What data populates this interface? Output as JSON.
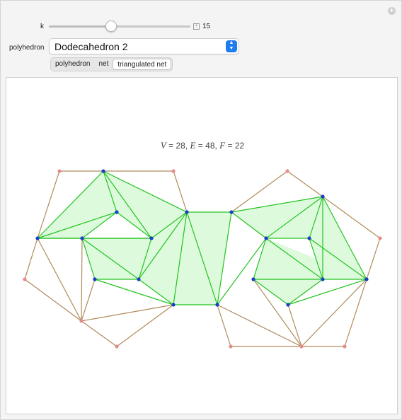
{
  "controls": {
    "k_label": "k",
    "k_value": "15",
    "k_fraction": 0.44,
    "polyhedron_label": "polyhedron",
    "polyhedron_selected": "Dodecahedron 2",
    "view_tabs": [
      {
        "label": "polyhedron",
        "active": false
      },
      {
        "label": "net",
        "active": false
      },
      {
        "label": "triangulated net",
        "active": true
      }
    ]
  },
  "stats": {
    "V_symbol": "V",
    "V_value": "28",
    "E_symbol": "E",
    "E_value": "48",
    "F_symbol": "F",
    "F_value": "22"
  },
  "colors": {
    "face_fill": "#ddfadd",
    "edge_green": "#22c41e",
    "edge_brown": "#b08a5a",
    "vertex_blue": "#1a3dcc",
    "vertex_pink": "#e88a8a",
    "accent": "#1f7cf0"
  }
}
